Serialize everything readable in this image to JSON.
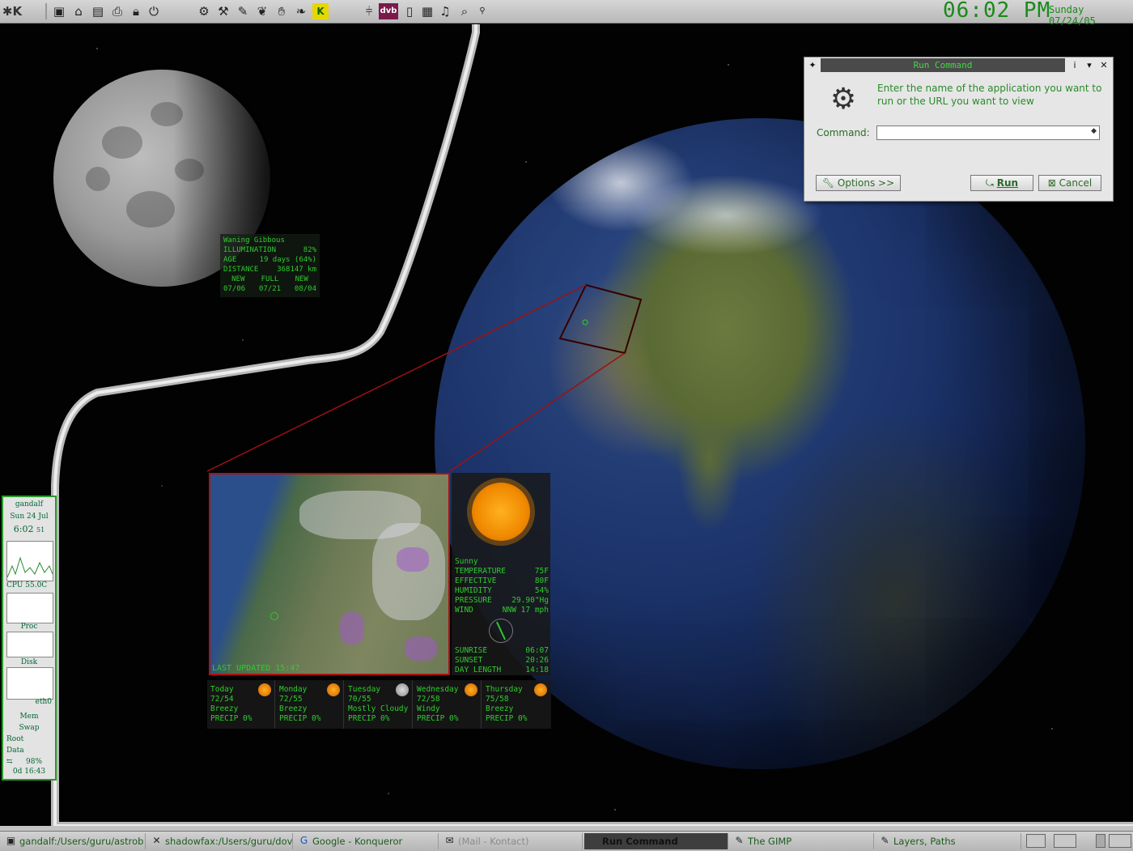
{
  "topbar": {
    "icons": [
      "kmenu-icon",
      "desktop-icon",
      "home-icon",
      "terminal-icon",
      "printer-icon",
      "lock-icon",
      "power-icon",
      "settings-icon",
      "network-icon",
      "editor-icon",
      "fish-icon",
      "hand-icon",
      "leaf-icon",
      "kde-k-icon",
      "mixer-icon",
      "dvb-icon",
      "clipboard-icon",
      "calendar-icon",
      "music-icon",
      "image-icon",
      "search-icon"
    ],
    "dvb_label": "dvb",
    "k_label": "K",
    "clock_time": "06:02 PM",
    "clock_date": "Sunday 07/24/05"
  },
  "monitor": {
    "hostname": "gandalf",
    "date": "Sun 24 Jul",
    "time": "6:02",
    "seconds": "51",
    "cpu_label": "CPU",
    "cpu_value": "55.0C",
    "proc_label": "Proc",
    "disk_label": "Disk",
    "eth_label": "eth0",
    "mem_label": "Mem",
    "swap_label": "Swap",
    "root_label": "Root",
    "data_label": "Data",
    "battery": "98%",
    "uptime": "0d 16:43"
  },
  "moon": {
    "phase": "Waning Gibbous",
    "illum_label": "ILLUMINATION",
    "illum": "82%",
    "age_label": "AGE",
    "age": "19 days (64%)",
    "dist_label": "DISTANCE",
    "dist": "368147 km",
    "phases": [
      "NEW",
      "FULL",
      "NEW"
    ],
    "dates": [
      "07/06",
      "07/21",
      "08/04"
    ]
  },
  "weather": {
    "updated": "LAST UPDATED 15:47",
    "condition": "Sunny",
    "rows": [
      {
        "label": "TEMPERATURE",
        "value": "75F"
      },
      {
        "label": "EFFECTIVE",
        "value": "80F"
      },
      {
        "label": "HUMIDITY",
        "value": "54%"
      },
      {
        "label": "PRESSURE",
        "value": "29.90\"Hg"
      },
      {
        "label": "WIND",
        "value": "NNW 17 mph"
      }
    ],
    "sun_rows": [
      {
        "label": "SUNRISE",
        "value": "06:07"
      },
      {
        "label": "SUNSET",
        "value": "20:26"
      },
      {
        "label": "DAY LENGTH",
        "value": "14:18"
      }
    ],
    "forecast": [
      {
        "day": "Today",
        "temps": "72/54",
        "desc": "Breezy",
        "precip": "PRECIP 0%"
      },
      {
        "day": "Monday",
        "temps": "72/55",
        "desc": "Breezy",
        "precip": "PRECIP 0%"
      },
      {
        "day": "Tuesday",
        "temps": "70/55",
        "desc": "Mostly Cloudy",
        "precip": "PRECIP 0%"
      },
      {
        "day": "Wednesday",
        "temps": "72/58",
        "desc": "Windy",
        "precip": "PRECIP 0%"
      },
      {
        "day": "Thursday",
        "temps": "75/58",
        "desc": "Breezy",
        "precip": "PRECIP 0%"
      }
    ]
  },
  "run_command": {
    "title": "Run Command",
    "message": "Enter the name of the application you want to run or the URL you want to view",
    "command_label": "Command:",
    "command_value": "",
    "options_label": "Options >>",
    "run_label": "Run",
    "cancel_label": "Cancel"
  },
  "taskbar": {
    "tasks": [
      {
        "label": "gandalf:/Users/guru/astrob",
        "icon": "terminal-icon"
      },
      {
        "label": "shadowfax:/Users/guru/dov",
        "icon": "x-icon"
      },
      {
        "label": "Google - Konqueror",
        "icon": "google-icon"
      },
      {
        "label": "(Mail - Kontact)",
        "icon": "mail-icon"
      },
      {
        "label": "Run Command",
        "icon": ""
      },
      {
        "label": "The GIMP",
        "icon": "gimp-icon"
      },
      {
        "label": "Layers, Paths",
        "icon": "gimp-icon"
      }
    ]
  }
}
